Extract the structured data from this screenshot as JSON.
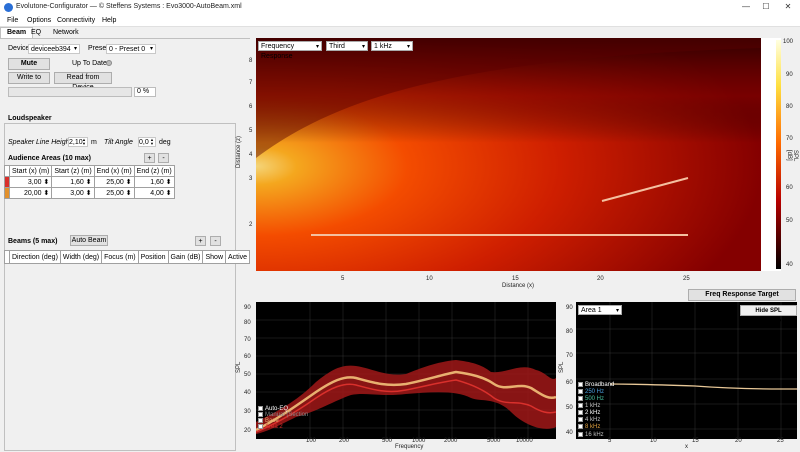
{
  "window": {
    "title": "Evolutone-Configurator — © Steffens Systems : Evo3000-AutoBeam.xml",
    "minimize": "—",
    "maximize": "☐",
    "close": "✕"
  },
  "menu": [
    "File",
    "Options",
    "Connectivity",
    "Help"
  ],
  "tabs": [
    "Beam",
    "EQ",
    "Network"
  ],
  "device": {
    "device_label": "Device",
    "device_value": "deviceeb394",
    "preset_label": "Preset",
    "preset_value": "0 - Preset 0",
    "mute_label": "Mute",
    "uptodate_label": "Up To Date:",
    "write_label": "Write to",
    "read_label": "Read from Device",
    "progress_text": "0 %"
  },
  "loudspeaker": {
    "title": "Loudspeaker",
    "line_height_label": "Speaker Line Height",
    "line_height_value": "2,10",
    "line_height_unit": "m",
    "tilt_label": "Tilt Angle",
    "tilt_value": "0,0",
    "tilt_unit": "deg"
  },
  "audience": {
    "title": "Audience Areas (10 max)",
    "add": "+",
    "remove": "-",
    "columns": [
      "Start (x) (m)",
      "Start (z) (m)",
      "End (x) (m)",
      "End (z) (m)"
    ],
    "rows": [
      {
        "color": "#d9302c",
        "cells": [
          "3,00",
          "1,60",
          "25,00",
          "1,60"
        ]
      },
      {
        "color": "#e2902c",
        "cells": [
          "20,00",
          "3,00",
          "25,00",
          "4,00"
        ]
      }
    ]
  },
  "beams": {
    "title": "Beams (5 max)",
    "auto_beam": "Auto Beam",
    "add": "+",
    "remove": "-",
    "columns": [
      "Direction (deg)",
      "Width (deg)",
      "Focus (m)",
      "Position",
      "Gain (dB)",
      "Show",
      "Active"
    ]
  },
  "heatmap": {
    "mode": "Frequency Response",
    "smoothing": "Third",
    "frequency": "1 kHz",
    "xlabel": "Distance (x)",
    "ylabel": "Distance (z)",
    "cbar_label": "SPL [dB]",
    "xticks": [
      "5",
      "10",
      "15",
      "20",
      "25"
    ],
    "yticks": [
      "8",
      "7",
      "6",
      "5",
      "4",
      "3",
      "2"
    ],
    "cbar_ticks": [
      "100",
      "90",
      "80",
      "70",
      "60",
      "50",
      "40"
    ]
  },
  "freq_target_btn": "Freq Response Target",
  "hide_spl_btn": "Hide SPL distribution",
  "area_select": "Area 1",
  "freqplot": {
    "ylabel": "SPL",
    "xlabel": "Frequency",
    "yticks": [
      "90",
      "80",
      "70",
      "60",
      "50",
      "40",
      "30",
      "20"
    ],
    "xticks": [
      "100",
      "200",
      "500",
      "1000",
      "2000",
      "5000",
      "10000"
    ],
    "legend": [
      {
        "label": "Auto-EQ",
        "color": "#ffffff"
      },
      {
        "label": "Manual (Section",
        "color": "#888888"
      },
      {
        "label": "Base",
        "color": "#e8b070"
      },
      {
        "label": "Area 2",
        "color": "#d9302c"
      }
    ]
  },
  "areaplot": {
    "ylabel": "SPL",
    "xlabel": "x",
    "yticks": [
      "90",
      "80",
      "70",
      "60",
      "50",
      "40"
    ],
    "xticks": [
      "5",
      "10",
      "15",
      "20",
      "25"
    ],
    "legend": [
      {
        "label": "Broadband",
        "color": "#ffffff"
      },
      {
        "label": "250 Hz",
        "color": "#4aa0e0"
      },
      {
        "label": "500 Hz",
        "color": "#4ac0a0"
      },
      {
        "label": "1 kHz",
        "color": "#c0c0c0"
      },
      {
        "label": "2 kHz",
        "color": "#ffffff"
      },
      {
        "label": "4 kHz",
        "color": "#c0c0c0"
      },
      {
        "label": "8 kHz",
        "color": "#e0a040"
      },
      {
        "label": "16 kHz",
        "color": "#c0c0c0"
      }
    ]
  }
}
